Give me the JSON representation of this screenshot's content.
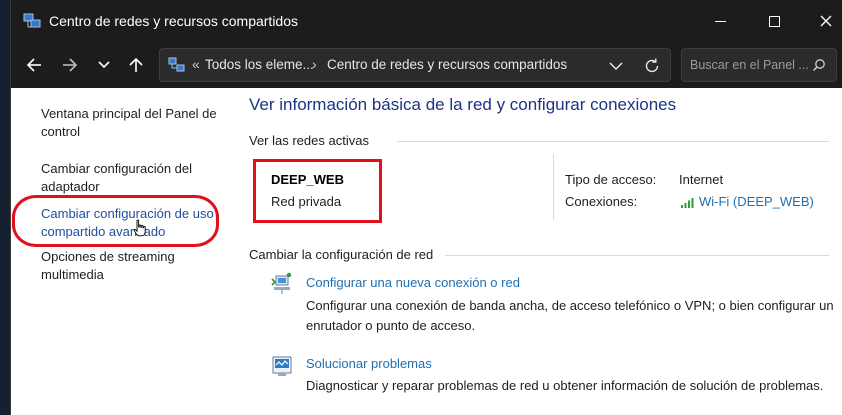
{
  "window": {
    "title": "Centro de redes y recursos compartidos"
  },
  "address_bar": {
    "root_marker": "«",
    "segment1": "Todos los eleme...",
    "separator": "›",
    "segment2": "Centro de redes y recursos compartidos"
  },
  "search": {
    "placeholder": "Buscar en el Panel ..."
  },
  "sidebar": {
    "items": [
      {
        "label1": "Ventana principal del Panel de",
        "label2": "control"
      },
      {
        "label1": "Cambiar configuración del",
        "label2": "adaptador"
      },
      {
        "label1": "Cambiar configuración de uso",
        "label2": "compartido avanzado"
      },
      {
        "label1": "Opciones de streaming",
        "label2": "multimedia"
      }
    ]
  },
  "main": {
    "title": "Ver información básica de la red y configurar conexiones",
    "active_networks_heading": "Ver las redes activas",
    "network": {
      "name": "DEEP_WEB",
      "type": "Red privada",
      "access_label": "Tipo de acceso:",
      "access_value": "Internet",
      "connections_label": "Conexiones:",
      "connection_link": "Wi-Fi (DEEP_WEB)"
    },
    "change_heading": "Cambiar la configuración de red",
    "tasks": [
      {
        "icon": "new-connection-icon",
        "link": "Configurar una nueva conexión o red",
        "desc1": "Configurar una conexión de banda ancha, de acceso telefónico o VPN; o bien configurar un",
        "desc2": "enrutador o punto de acceso."
      },
      {
        "icon": "troubleshoot-icon",
        "link": "Solucionar problemas",
        "desc1": "Diagnosticar y reparar problemas de red u obtener información de solución de problemas."
      }
    ]
  },
  "colors": {
    "annotation": "#e0101c",
    "title_blue": "#1e3287",
    "link_blue": "#1f6fb0",
    "dark_chrome": "#1c1c1c"
  }
}
